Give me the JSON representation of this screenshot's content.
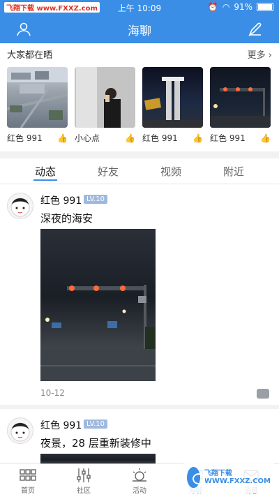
{
  "status_bar": {
    "left_badge": "飞翔下载 www.FXXZ.com",
    "time": "上午 10:09",
    "battery": "91%",
    "battery_level": 0.91
  },
  "header": {
    "title": "海聊"
  },
  "showcase": {
    "title": "大家都在晒",
    "more_label": "更多 ›",
    "items": [
      {
        "name": "红色 991"
      },
      {
        "name": "小心点"
      },
      {
        "name": "红色 991"
      },
      {
        "name": "红色 991"
      }
    ]
  },
  "tabs": [
    "动态",
    "好友",
    "视频",
    "附近"
  ],
  "posts": [
    {
      "user": "红色 991",
      "level": "LV.10",
      "text": "深夜的海安",
      "date": "10-12"
    },
    {
      "user": "红色 991",
      "level": "LV.10",
      "text": "夜景，28 层重新装修中"
    }
  ],
  "bottom_nav": [
    "首页",
    "社区",
    "活动",
    "海聊",
    "消息"
  ],
  "watermark": "飞翔下载 WWW.FXXZ.COM",
  "colors": {
    "accent": "#3a8ee6",
    "level_badge": "#9fb8dd"
  }
}
